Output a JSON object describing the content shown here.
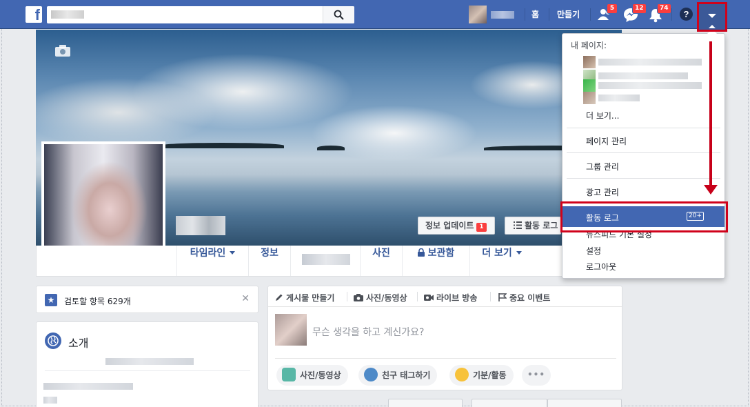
{
  "header": {
    "logo": "f",
    "home_label": "홈",
    "create_label": "만들기",
    "friend_requests_count": "5",
    "messages_count": "12",
    "notifications_count": "74",
    "help_label": "?"
  },
  "cover": {
    "update_info_label": "정보 업데이트",
    "update_info_count": "1",
    "activity_log_label": "활동 로그"
  },
  "tabs": {
    "timeline": "타임라인",
    "about": "정보",
    "photos": "사진",
    "archive": "보관함",
    "more": "더 보기"
  },
  "review": {
    "text": "검토할 항목 629개",
    "close": "✕"
  },
  "intro": {
    "title": "소개"
  },
  "composer": {
    "tab_create_post": "게시물 만들기",
    "tab_photo_video": "사진/동영상",
    "tab_live": "라이브 방송",
    "tab_life_event": "중요 이벤트",
    "placeholder": "무슨 생각을 하고 계신가요?",
    "photo_video_button": "사진/동영상",
    "tag_friends_button": "친구 태그하기",
    "feeling_button": "기분/활동",
    "more_button": "•••"
  },
  "dropdown": {
    "my_pages_header": "내 페이지:",
    "see_more": "더 보기...",
    "manage_pages": "페이지 관리",
    "manage_groups": "그룹 관리",
    "manage_ads": "광고 관리",
    "activity_log": "활동 로그",
    "activity_log_count": "20+",
    "news_feed_prefs": "뉴스피드 기본 설정",
    "settings": "설정",
    "logout": "로그아웃"
  },
  "accent_colors": {
    "facebook_blue": "#4267b2",
    "annotation_red": "#d0021b",
    "badge_red": "#fa3e3e"
  }
}
